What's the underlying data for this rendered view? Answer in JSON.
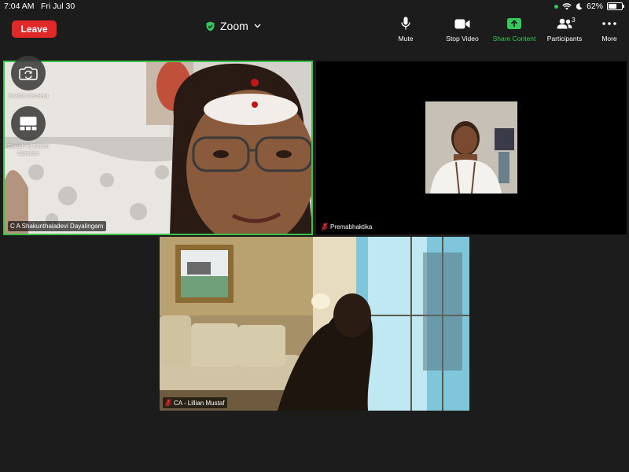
{
  "status_bar": {
    "time": "7:04 AM",
    "date": "Fri Jul 30",
    "battery": "62%",
    "battery_level": 0.62
  },
  "toolbar": {
    "leave_label": "Leave",
    "meeting_title": "Zoom",
    "mute_label": "Mute",
    "stop_video_label": "Stop Video",
    "share_content_label": "Share Content",
    "participants_label": "Participants",
    "participants_count": "3",
    "more_label": "More"
  },
  "floating_controls": {
    "switch_camera_label": "Switch Camera",
    "switch_active_label": "Switch to Active Speaker"
  },
  "participants": [
    {
      "name": "C A Shakunthaladevi Dayalingam",
      "muted": false,
      "active_speaker": true
    },
    {
      "name": "Premabhaktika",
      "muted": true,
      "active_speaker": false
    },
    {
      "name": "CA - Lillian Mustaf",
      "muted": true,
      "active_speaker": false
    }
  ],
  "colors": {
    "background": "#1c1c1c",
    "leave": "#e02828",
    "accent_green": "#34c759",
    "active_border": "#3ac24a",
    "muted_icon": "#e02828"
  },
  "icons": {
    "shield": "shield-check-icon",
    "chevron": "chevron-down-icon",
    "mute": "microphone-icon",
    "video": "video-camera-icon",
    "share": "share-arrow-icon",
    "participants": "people-icon",
    "more": "ellipsis-icon",
    "switch_camera": "camera-rotate-icon",
    "active_speaker": "speaker-view-icon",
    "muted": "muted-microphone-icon"
  }
}
